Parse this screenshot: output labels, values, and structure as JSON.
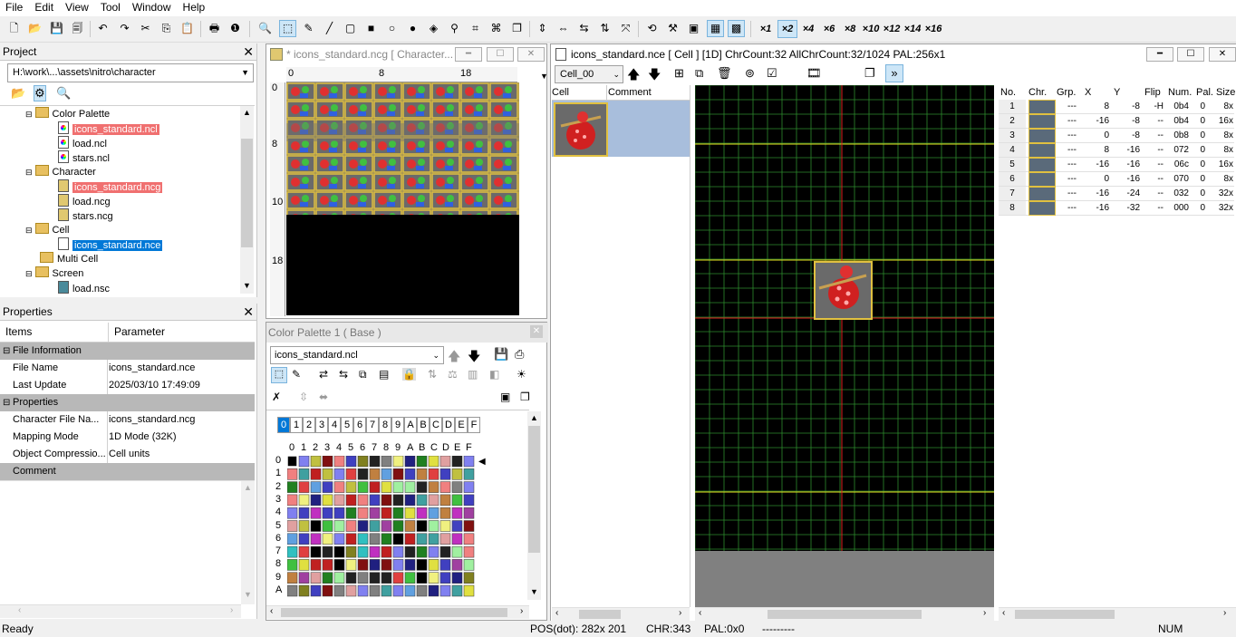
{
  "menu": [
    "File",
    "Edit",
    "View",
    "Tool",
    "Window",
    "Help"
  ],
  "zoom_levels": [
    "×1",
    "×2",
    "×4",
    "×6",
    "×8",
    "×10",
    "×12",
    "×14",
    "×16"
  ],
  "zoom_selected": "×2",
  "project": {
    "title": "Project",
    "path": "H:\\work\\...\\assets\\nitro\\character",
    "tree": {
      "color_palette": "Color Palette",
      "cp_items": [
        "icons_standard.ncl",
        "load.ncl",
        "stars.ncl"
      ],
      "character": "Character",
      "ch_items": [
        "icons_standard.ncg",
        "load.ncg",
        "stars.ncg"
      ],
      "cell": "Cell",
      "cell_items": [
        "icons_standard.nce"
      ],
      "multi_cell": "Multi Cell",
      "screen": "Screen",
      "screen_items": [
        "load.nsc"
      ]
    }
  },
  "properties": {
    "title": "Properties",
    "col_items": "Items",
    "col_param": "Parameter",
    "group_file": "File Information",
    "file_name_k": "File Name",
    "file_name_v": "icons_standard.nce",
    "last_update_k": "Last Update",
    "last_update_v": "2025/03/10 17:49:09",
    "group_props": "Properties",
    "char_file_k": "Character File Na...",
    "char_file_v": "icons_standard.ncg",
    "mapping_k": "Mapping Mode",
    "mapping_v": "1D Mode (32K)",
    "compress_k": "Object Compressio...",
    "compress_v": "Cell units",
    "comment_k": "Comment"
  },
  "char_window": {
    "title": "* icons_standard.ncg [ Character...",
    "ruler_top": [
      "0",
      "8",
      "18"
    ],
    "ruler_left": [
      "0",
      "8",
      "10",
      "18"
    ]
  },
  "palette_window": {
    "title": "Color Palette 1 ( Base )",
    "file": "icons_standard.ncl",
    "tabs": [
      "0",
      "1",
      "2",
      "3",
      "4",
      "5",
      "6",
      "7",
      "8",
      "9",
      "A",
      "B",
      "C",
      "D",
      "E",
      "F"
    ],
    "col_heads": [
      "0",
      "1",
      "2",
      "3",
      "4",
      "5",
      "6",
      "7",
      "8",
      "9",
      "A",
      "B",
      "C",
      "D",
      "E",
      "F"
    ],
    "row_heads": [
      "0",
      "1",
      "2",
      "3",
      "4",
      "5",
      "6",
      "7",
      "8",
      "9",
      "A"
    ]
  },
  "cell_window": {
    "title": "icons_standard.nce [ Cell ] [1D] ChrCount:32 AllChrCount:32/1024  PAL:256x1",
    "cell_select": "Cell_00",
    "col_cell": "Cell",
    "col_comment": "Comment",
    "oam_headers": [
      "No.",
      "Chr.",
      "Grp.",
      "X",
      "Y",
      "Flip",
      "Num.",
      "Pal.",
      "Size"
    ],
    "oam_rows": [
      {
        "no": "1",
        "grp": "---",
        "x": "8",
        "y": "-8",
        "flip": "-H",
        "num": "0b4",
        "pal": "0",
        "size": "8x"
      },
      {
        "no": "2",
        "grp": "---",
        "x": "-16",
        "y": "-8",
        "flip": "--",
        "num": "0b4",
        "pal": "0",
        "size": "16x"
      },
      {
        "no": "3",
        "grp": "---",
        "x": "0",
        "y": "-8",
        "flip": "--",
        "num": "0b8",
        "pal": "0",
        "size": "8x"
      },
      {
        "no": "4",
        "grp": "---",
        "x": "8",
        "y": "-16",
        "flip": "--",
        "num": "072",
        "pal": "0",
        "size": "8x"
      },
      {
        "no": "5",
        "grp": "---",
        "x": "-16",
        "y": "-16",
        "flip": "--",
        "num": "06c",
        "pal": "0",
        "size": "16x"
      },
      {
        "no": "6",
        "grp": "---",
        "x": "0",
        "y": "-16",
        "flip": "--",
        "num": "070",
        "pal": "0",
        "size": "8x"
      },
      {
        "no": "7",
        "grp": "---",
        "x": "-16",
        "y": "-24",
        "flip": "--",
        "num": "032",
        "pal": "0",
        "size": "32x"
      },
      {
        "no": "8",
        "grp": "---",
        "x": "-16",
        "y": "-32",
        "flip": "--",
        "num": "000",
        "pal": "0",
        "size": "32x"
      }
    ]
  },
  "status": {
    "ready": "Ready",
    "pos": "POS(dot): 282x 201",
    "chr": "CHR:343",
    "pal": "PAL:0x0",
    "dashes": "---------",
    "num": "NUM"
  },
  "colors": {
    "selection_red": "#f07070",
    "selection_blue": "#0078d7",
    "grid_green": "#2e8b2e",
    "axis_red": "#e02020",
    "guide_yellow": "#e8e020"
  }
}
